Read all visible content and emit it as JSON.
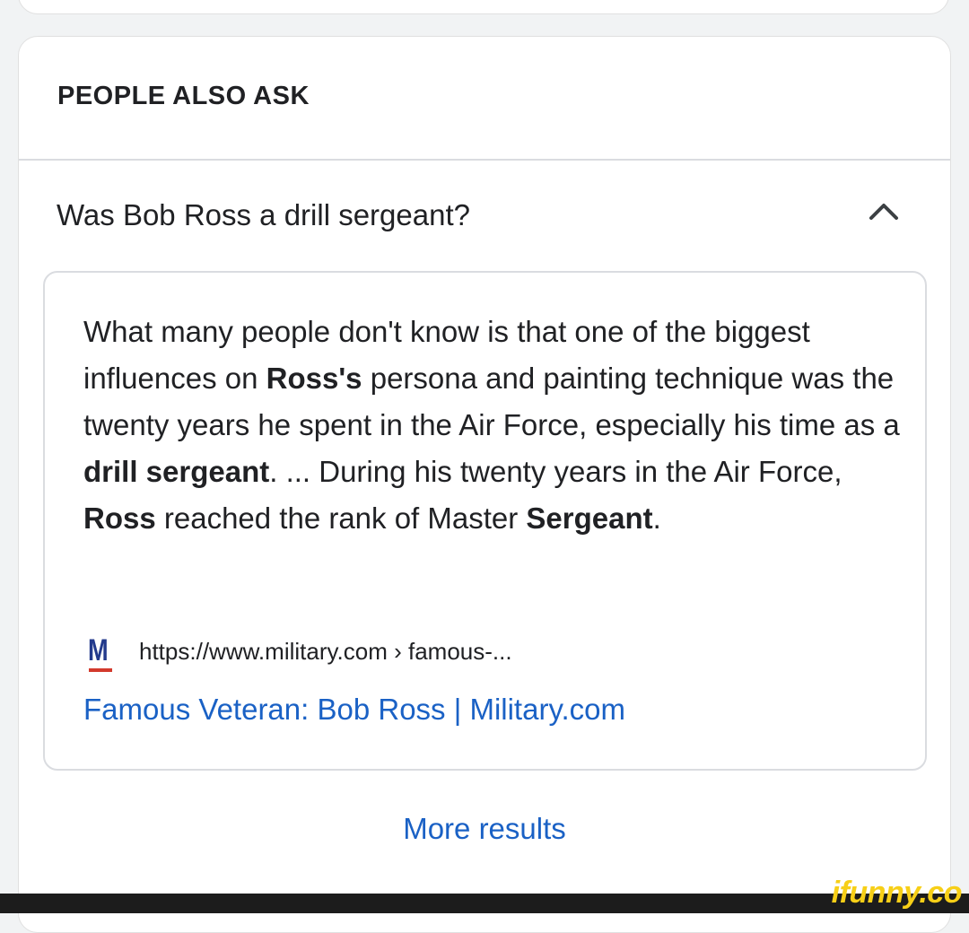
{
  "people_also_ask": {
    "title": "PEOPLE ALSO ASK",
    "question": "Was Bob Ross a drill sergeant?",
    "expanded_icon": "chevron-up-icon",
    "answer": {
      "segments": [
        {
          "text": "What many people don't know is that one of the biggest influences on ",
          "bold": false
        },
        {
          "text": "Ross's",
          "bold": true
        },
        {
          "text": " persona and painting technique was the twenty years he spent in the Air Force, especially his time as a ",
          "bold": false
        },
        {
          "text": "drill sergeant",
          "bold": true
        },
        {
          "text": ". ... During his twenty years in the Air Force, ",
          "bold": false
        },
        {
          "text": "Ross",
          "bold": true
        },
        {
          "text": " reached the rank of Master ",
          "bold": false
        },
        {
          "text": "Sergeant",
          "bold": true
        },
        {
          "text": ".",
          "bold": false
        }
      ]
    },
    "source": {
      "favicon_letter": "M",
      "favicon_color": "#233a8c",
      "favicon_accent": "#d33a2c",
      "url": "https://www.military.com › famous-...",
      "link_title": "Famous Veteran: Bob Ross | Military.com"
    },
    "more_results": "More results"
  },
  "watermark": {
    "text": "ifunny.co",
    "color": "#f7cf17"
  },
  "colors": {
    "link": "#1a61c5",
    "text": "#202124",
    "divider": "#dadce0"
  }
}
